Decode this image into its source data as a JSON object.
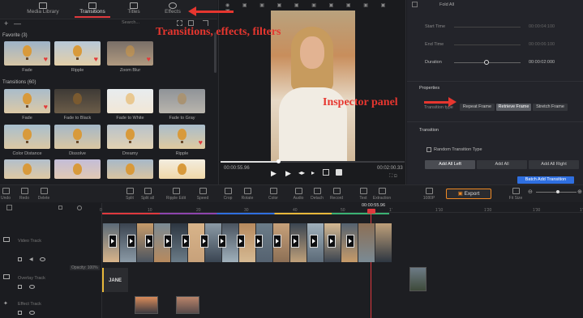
{
  "tabs": [
    {
      "label": "Media Library"
    },
    {
      "label": "Transitions"
    },
    {
      "label": "Titles"
    },
    {
      "label": "Effects"
    }
  ],
  "search": {
    "placeholder": "Search..."
  },
  "favorite": {
    "header": "Favorite (3)",
    "items": [
      "Fade",
      "Ripple",
      "Zoom Blur"
    ]
  },
  "transitions": {
    "header": "Transitions (60)",
    "items": [
      "Fade",
      "Fade to Black",
      "Fade to White",
      "Fade to Gray",
      "Color Distance",
      "Dissolve",
      "Dreamy",
      "Ripple"
    ]
  },
  "preview": {
    "time_current": "00:00:55.96",
    "time_total": "00:02:00.33"
  },
  "inspector": {
    "fold_all": "Fold All",
    "start_time": "Start Time",
    "start_time_val": "00:00:04:100",
    "end_time": "End Time",
    "end_time_val": "00:00:06:100",
    "duration": "Duration",
    "duration_val": "00:00:02:000",
    "properties": "Properties",
    "transition_type": "Transition type",
    "buttons": [
      "Repeat Frame",
      "Retrieve Frame",
      "Stretch Frame"
    ],
    "transition": "Transition",
    "random": "Random Transition Type",
    "apply": [
      "Add All Left",
      "Add All",
      "Add All Right"
    ],
    "batch": "Batch Add Transition"
  },
  "toolbar": {
    "tools": [
      "Undo",
      "Redo",
      "Delete",
      "Split",
      "Split all",
      "Ripple Edit",
      "Speed",
      "Crop",
      "Rotate",
      "Color",
      "Audio",
      "Detach",
      "Record",
      "Text",
      "Extraction"
    ],
    "resolution": "1080P",
    "export": "Export",
    "fit": "Fit Size"
  },
  "ruler": [
    "0",
    "10",
    "20",
    "30",
    "40",
    "50",
    "1'",
    "1'10",
    "1'20",
    "1'30",
    "1'40"
  ],
  "playhead": "00:00:55.96",
  "tracks": {
    "video": "Video Track",
    "overlay": "Overlay Track",
    "effect": "Effect Track",
    "opacity": "Opacity: 100%",
    "overlay_text": "JANE"
  },
  "annotations": {
    "left": "Transitions, effects, filters",
    "right": "Inspector panel"
  },
  "colors": {
    "accent": "#e0393e",
    "annotation": "#e6362f",
    "batch": "#2f6fe0",
    "export": "#f08a24",
    "selected": "#5a5d63"
  }
}
